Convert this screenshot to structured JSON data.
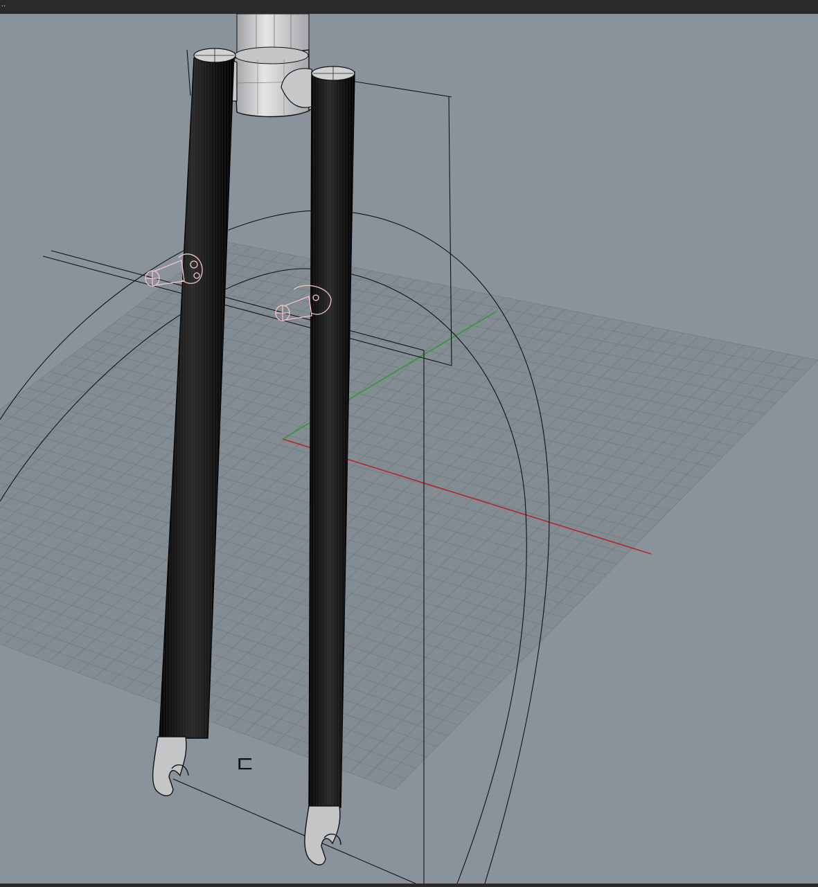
{
  "window": {
    "title_dots": ".."
  },
  "viewport": {
    "view": "perspective",
    "background_color": "#8a939c",
    "grid_color": "#727b84",
    "x_axis_color": "#b4282a",
    "y_axis_color": "#2f9a2f",
    "curve_color": "#111111",
    "selection_color": "#f6c5c5",
    "tube_fill": "#191919",
    "steerer_fill": "#c9cbcd",
    "sketch_mark": "ㄷ"
  }
}
